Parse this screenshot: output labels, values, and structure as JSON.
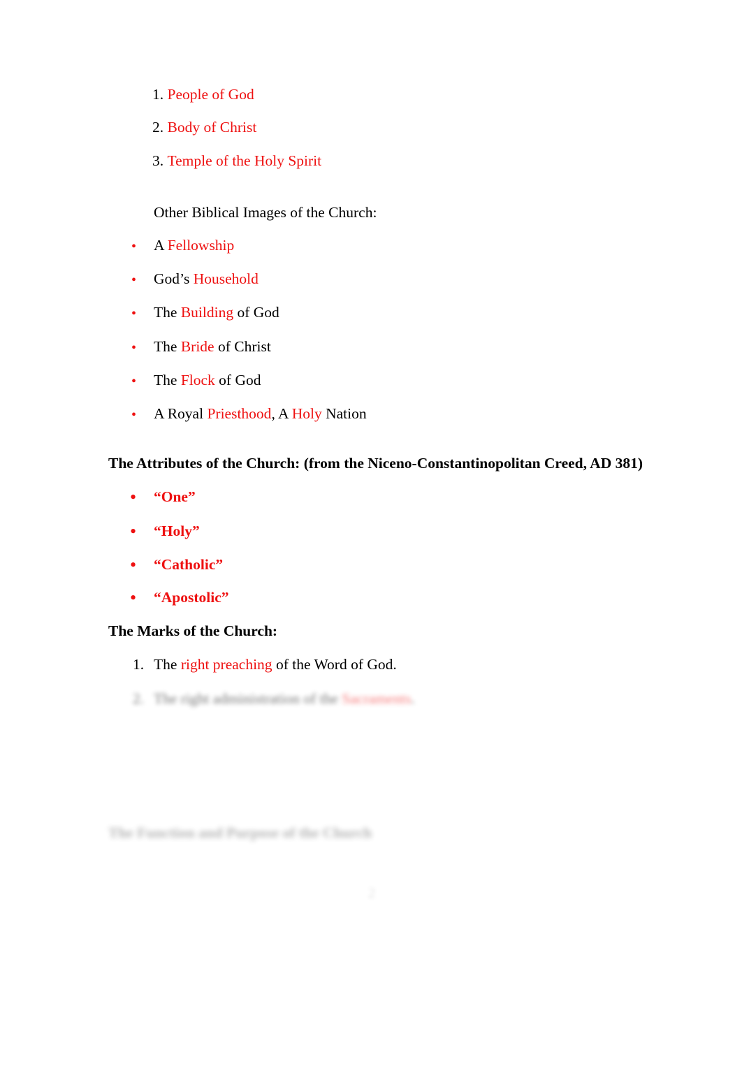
{
  "document": {
    "page_number": "2",
    "colors": {
      "accent_red": "#ee1111",
      "body_black": "#000000",
      "page_background": "#ffffff"
    }
  },
  "images_of_church": {
    "numbered_items": [
      {
        "marker": "1.",
        "text": "People of God"
      },
      {
        "marker": "2.",
        "text": "Body of Christ"
      },
      {
        "marker": "3.",
        "text": "Temple of the Holy Spirit"
      }
    ]
  },
  "other_images": {
    "intro": "Other Biblical Images of the Church:",
    "bullet_glyph": "•",
    "items": [
      {
        "lead": "A ",
        "accent": "Fellowship",
        "tail": ""
      },
      {
        "lead": "God’s ",
        "accent": "Household",
        "tail": ""
      },
      {
        "lead": "The ",
        "accent": "Building",
        "tail": " of God"
      },
      {
        "lead": "The ",
        "accent": "Bride",
        "tail": " of Christ"
      },
      {
        "lead": "The ",
        "accent": "Flock",
        "tail": " of God"
      },
      {
        "lead": "A Royal ",
        "accent": "Priesthood",
        "tail": ", A ",
        "accent2": "Holy",
        "tail2": " Nation"
      }
    ]
  },
  "attributes": {
    "heading": "The Attributes of the Church: (from the Niceno-Constantinopolitan Creed, AD 381)",
    "bullet_glyph": "•",
    "items": [
      {
        "text": "“One”"
      },
      {
        "text": "“Holy”"
      },
      {
        "text": "“Catholic”"
      },
      {
        "text": "“Apostolic”"
      }
    ]
  },
  "marks": {
    "heading": "The Marks of the Church:",
    "items": [
      {
        "marker": "1.",
        "lead": "The ",
        "accent": "right preaching",
        "tail": " of the Word of God."
      },
      {
        "marker": "2.",
        "lead": "The right administration of the ",
        "accent": "Sacraments",
        "tail": "."
      }
    ]
  },
  "function_section": {
    "heading": "The Function and Purpose of the Church"
  }
}
